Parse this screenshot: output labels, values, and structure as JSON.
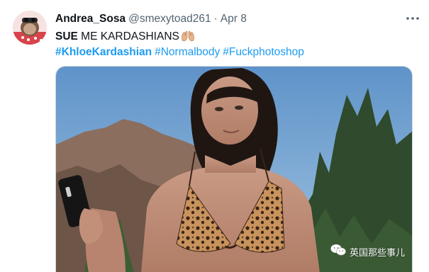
{
  "tweet": {
    "author_name": "Andrea_Sosa",
    "handle": "@smexytoad261",
    "separator": "·",
    "date": "Apr 8",
    "text_bold": "SUE",
    "text_rest": " ME KARDASHIANS",
    "hashtags": [
      "#KhloeKardashian",
      "#Normalbody",
      "#Fuckphotoshop"
    ],
    "icons": {
      "more": "more-horizontal-icon",
      "emoji": "raised-hands-emoji"
    },
    "colors": {
      "link": "#1d9bf0",
      "muted": "#536471",
      "text": "#0f1419"
    }
  },
  "watermark": {
    "text": "英国那些事儿",
    "icon": "wechat-logo"
  }
}
